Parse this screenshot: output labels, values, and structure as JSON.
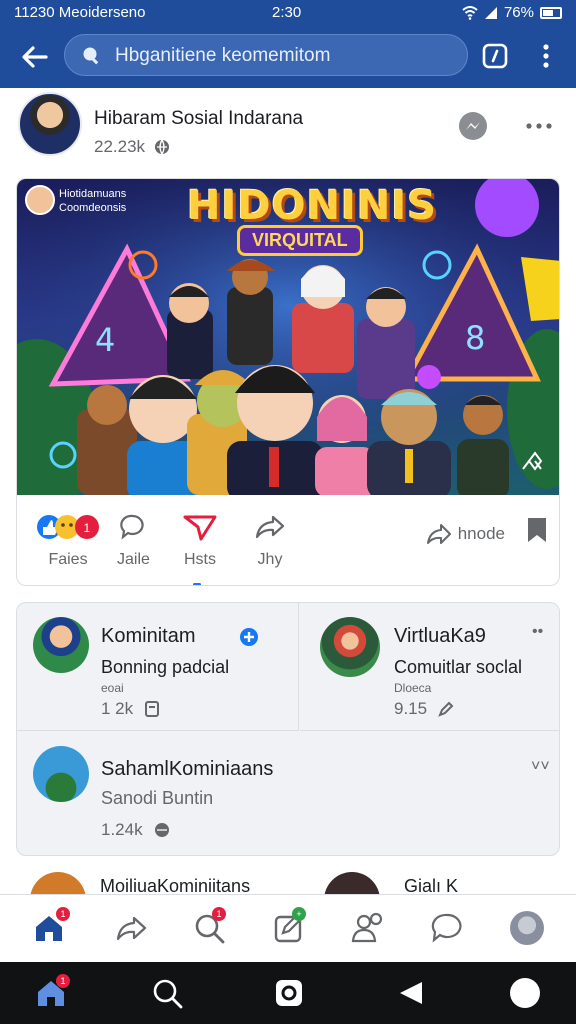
{
  "status": {
    "left": "11230 Meoiderseno",
    "time": "2:30",
    "right": "76%"
  },
  "appbar": {
    "search_text": "Hbganitiene keomemitom"
  },
  "post": {
    "title": "Hibaram Sosial Indarana",
    "meta": "22.23k"
  },
  "hero": {
    "title": "HIDONINIS",
    "subtitle": "VIRQUITAL",
    "caption_line1": "Hiotidamuans",
    "caption_line2": "Coomdeonsis"
  },
  "actions": [
    {
      "label": "Faies"
    },
    {
      "label": "Jaile"
    },
    {
      "label": "Hsts"
    },
    {
      "label": "Jhy"
    }
  ],
  "share_label": "hnode",
  "suggestions": {
    "c1": {
      "title": "Kominitam",
      "sub": "Bonning padcial",
      "small": "eoai",
      "meta": "1 2k"
    },
    "c2": {
      "title": "VirtluaKa9",
      "sub": "Comuitlar soclal",
      "small": "Dloeca",
      "meta": "9.15"
    },
    "c3": {
      "title": "SahamlKominiaans",
      "sub": "Sanodi Buntin",
      "meta": "1.24k"
    }
  },
  "peek": {
    "left": "MoiliuaKominiitans",
    "right": "Gialı K"
  },
  "badges": {
    "home": "1",
    "search": "1",
    "notif": "+",
    "nav_home": "1"
  },
  "colors": {
    "primary": "#1f4d9c",
    "accent": "#1877f2",
    "badge": "#e41e3f"
  }
}
